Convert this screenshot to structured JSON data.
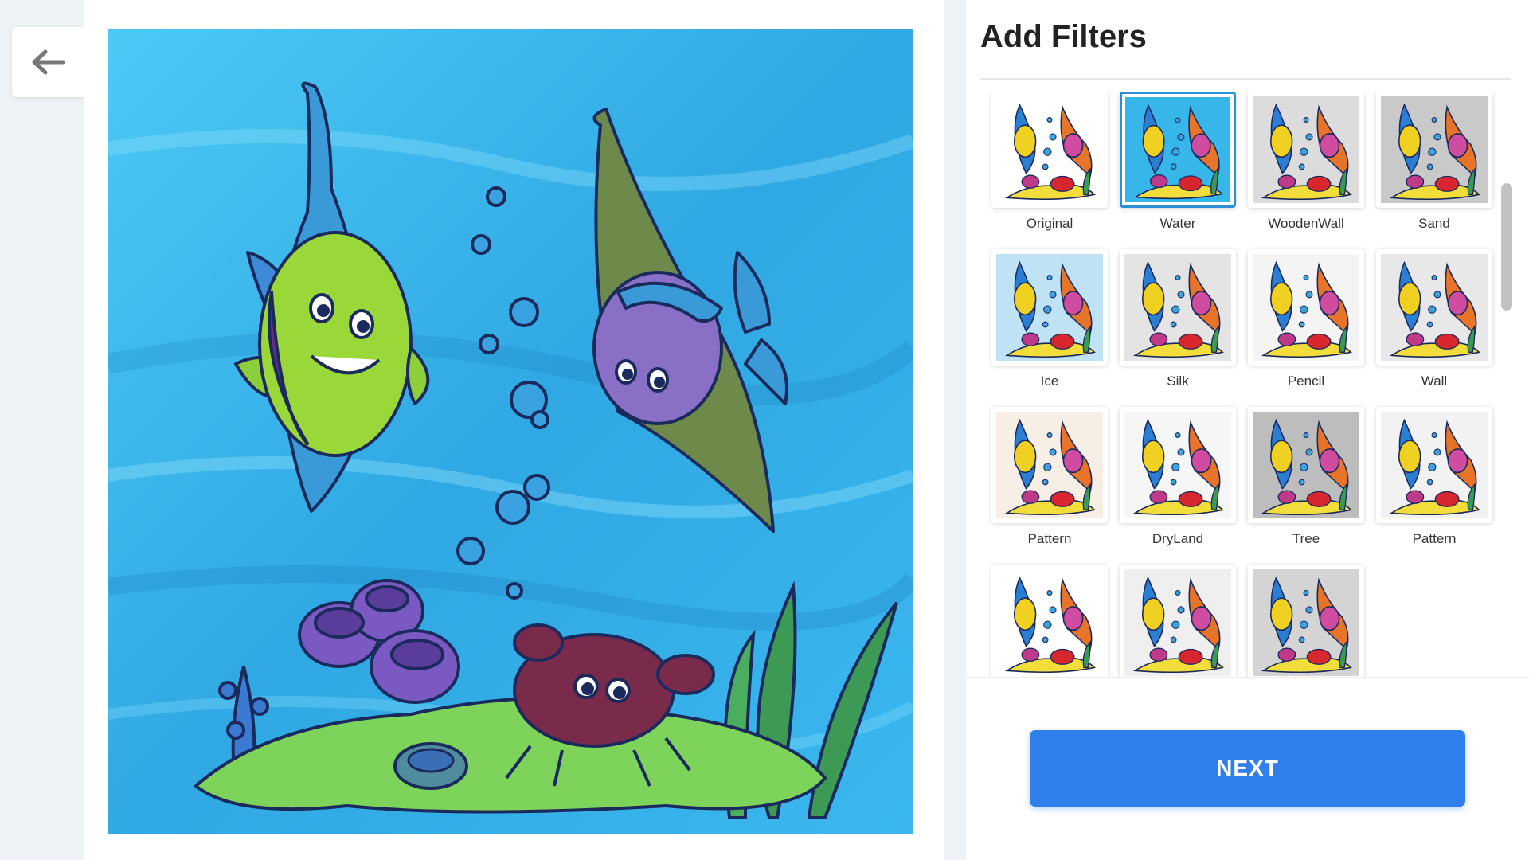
{
  "back_button": {
    "icon": "arrow-left-icon"
  },
  "panel": {
    "title": "Add Filters",
    "next_label": "NEXT"
  },
  "filters": [
    {
      "label": "Original",
      "bg": "#ffffff",
      "selected": false
    },
    {
      "label": "Water",
      "bg": "#37b6ea",
      "selected": true
    },
    {
      "label": "WoodenWall",
      "bg": "#dcdcdc",
      "selected": false
    },
    {
      "label": "Sand",
      "bg": "#c9c9c9",
      "selected": false
    },
    {
      "label": "Ice",
      "bg": "#bfe3f5",
      "selected": false
    },
    {
      "label": "Silk",
      "bg": "#e4e4e4",
      "selected": false
    },
    {
      "label": "Pencil",
      "bg": "#f4f4f4",
      "selected": false
    },
    {
      "label": "Wall",
      "bg": "#e8e8e8",
      "selected": false
    },
    {
      "label": "Pattern",
      "bg": "#f7eee5",
      "selected": false
    },
    {
      "label": "DryLand",
      "bg": "#f6f6f6",
      "selected": false
    },
    {
      "label": "Tree",
      "bg": "#bdbdbd",
      "selected": false
    },
    {
      "label": "Pattern",
      "bg": "#f2f2f2",
      "selected": false
    },
    {
      "label": "",
      "bg": "#ffffff",
      "selected": false
    },
    {
      "label": "",
      "bg": "#efefef",
      "selected": false
    },
    {
      "label": "",
      "bg": "#d4d4d4",
      "selected": false
    }
  ],
  "colors": {
    "accent": "#2f80ed",
    "selected_border": "#2b8fd6",
    "water_background": "#37b6ea"
  }
}
